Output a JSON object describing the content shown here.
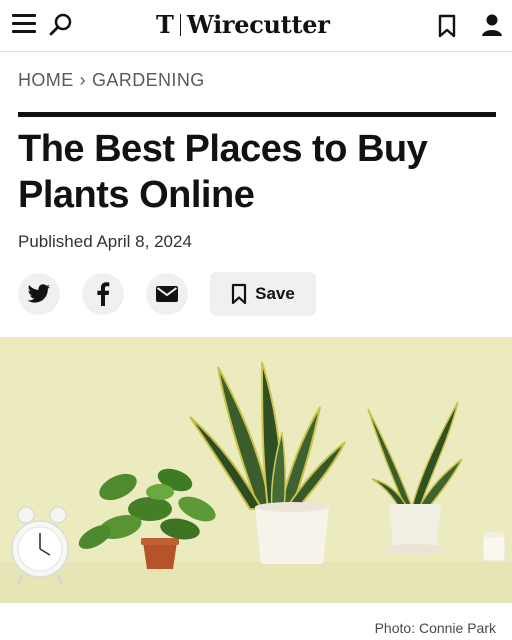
{
  "header": {
    "logo_mark": "T",
    "logo_text": "Wirecutter",
    "icons": {
      "menu": "hamburger-icon",
      "search": "search-icon",
      "bookmark": "bookmark-icon",
      "account": "account-icon"
    }
  },
  "breadcrumb": {
    "home": "HOME",
    "separator": "›",
    "section": "GARDENING"
  },
  "article": {
    "title": "The Best Places to Buy Plants Online",
    "published": "Published April 8, 2024"
  },
  "share": {
    "twitter_icon": "twitter-icon",
    "facebook_icon": "facebook-icon",
    "email_icon": "email-icon",
    "save_label": "Save",
    "save_icon": "bookmark-icon"
  },
  "hero": {
    "caption": "Photo: Connie Park",
    "background": "#ecebbf"
  },
  "colors": {
    "text": "#121212",
    "muted": "#5a5a5a",
    "button_bg": "#f0f0f0"
  }
}
